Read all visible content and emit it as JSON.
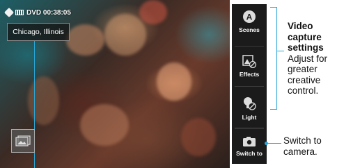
{
  "status": {
    "record_time": "DVD 00:38:05",
    "tag_icon": "tag-icon",
    "format_icon": "dvd-icon"
  },
  "location": {
    "label": "Chicago, Illinois"
  },
  "gallery": {
    "icon": "gallery-icon"
  },
  "panel": {
    "scenes": {
      "label": "Scenes",
      "icon": "scenes-icon",
      "glyph": "A"
    },
    "effects": {
      "label": "Effects",
      "icon": "effects-icon"
    },
    "light": {
      "label": "Light",
      "icon": "light-icon"
    },
    "switch_to": {
      "label": "Switch to",
      "icon": "camera-icon"
    }
  },
  "callouts": {
    "settings_title": "Video capture settings",
    "settings_body": "Adjust for greater creative control.",
    "switch": "Switch to camera."
  },
  "colors": {
    "callout_line": "#2aa7d8",
    "panel_bg": "#1b1b1b"
  }
}
